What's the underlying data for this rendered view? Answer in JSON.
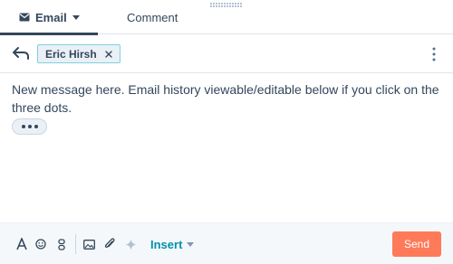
{
  "tabs": {
    "email_label": "Email",
    "comment_label": "Comment"
  },
  "recipient": {
    "name": "Eric Hirsh"
  },
  "message": {
    "body": "New message here. Email history viewable/editable below if you click on the three dots."
  },
  "toolbar": {
    "insert_label": "Insert",
    "send_label": "Send",
    "icons": [
      "text-format-icon",
      "emoji-icon",
      "snippets-icon",
      "image-icon",
      "attachment-icon",
      "ai-sparkle-icon"
    ]
  },
  "colors": {
    "send_button": "#ff7a59",
    "insert_link": "#0091ae",
    "text": "#33475b",
    "chip_border": "#7fd1de",
    "toolbar_bg": "#f5f8fa"
  }
}
